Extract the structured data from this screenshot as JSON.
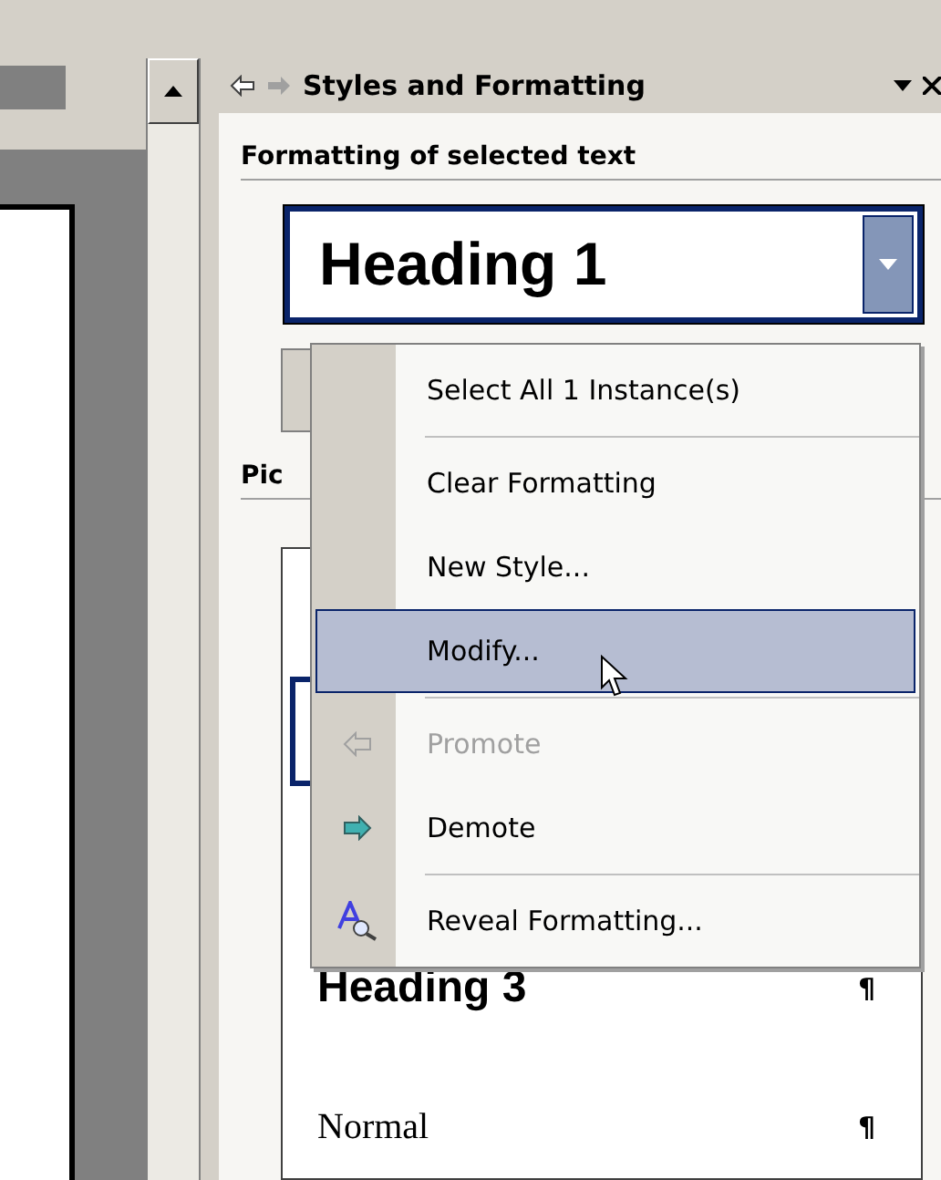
{
  "task_pane": {
    "title": "Styles and Formatting",
    "section_header": "Formatting of selected text",
    "current_style": "Heading 1",
    "list_header": "Pic"
  },
  "style_list": [
    {
      "selected": true,
      "kind": "blank"
    },
    {
      "label": "Heading 3",
      "mark": "¶",
      "selected": false,
      "kind": "heading"
    },
    {
      "label": "Normal",
      "mark": "¶",
      "selected": false,
      "kind": "normal"
    }
  ],
  "context_menu": [
    {
      "kind": "item",
      "label": "Select All 1 Instance(s)",
      "selected": false,
      "disabled": false
    },
    {
      "kind": "separator"
    },
    {
      "kind": "item",
      "label": "Clear Formatting",
      "selected": false,
      "disabled": false
    },
    {
      "kind": "item",
      "label": "New Style...",
      "selected": false,
      "disabled": false
    },
    {
      "kind": "item",
      "label": "Modify...",
      "selected": true,
      "disabled": false
    },
    {
      "kind": "separator"
    },
    {
      "kind": "item",
      "label": "Promote",
      "selected": false,
      "disabled": true
    },
    {
      "kind": "item",
      "label": "Demote",
      "selected": false,
      "disabled": false
    },
    {
      "kind": "separator"
    },
    {
      "kind": "item",
      "label": "Reveal Formatting...",
      "selected": false,
      "disabled": false
    }
  ]
}
